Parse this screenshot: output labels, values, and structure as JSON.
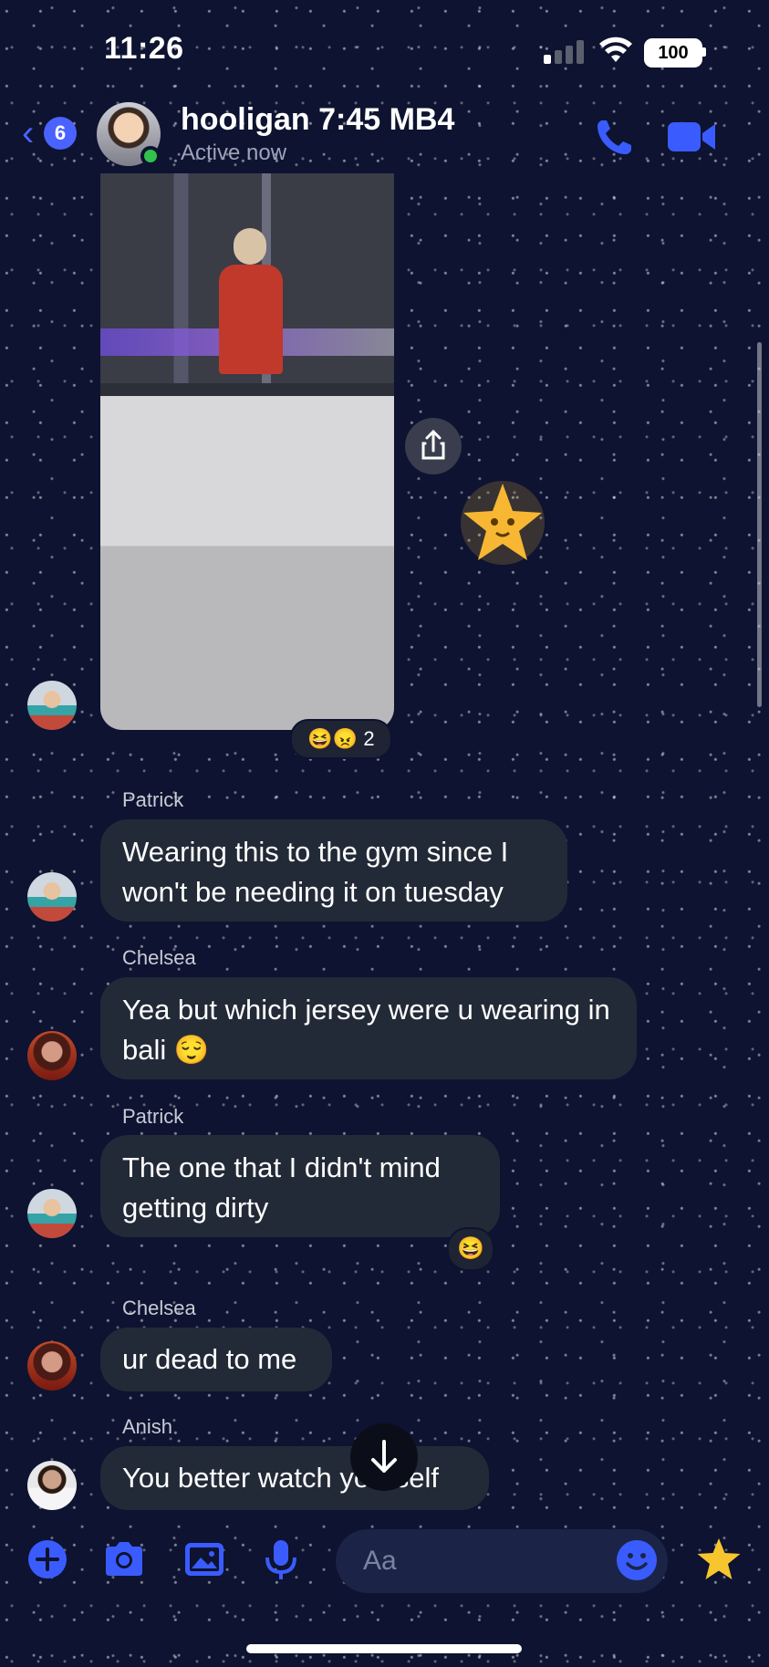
{
  "status_bar": {
    "time": "11:26",
    "battery": "100"
  },
  "header": {
    "back_badge": "6",
    "title": "hooligan 7:45 MB4",
    "subtitle": "Active now"
  },
  "photo_message": {
    "reactions": "😆😠 2"
  },
  "messages": [
    {
      "sender": "Patrick",
      "text": "Wearing this to the gym since I won't be needing it on tuesday"
    },
    {
      "sender": "Chelsea",
      "text": "Yea but which jersey were u wearing in bali 😌"
    },
    {
      "sender": "Patrick",
      "text": "The one that I didn't mind getting dirty",
      "reaction": "😆"
    },
    {
      "sender": "Chelsea",
      "text": "ur dead to me"
    },
    {
      "sender": "Anish",
      "text": "You better watch yourself"
    }
  ],
  "composer": {
    "placeholder": "Aa"
  },
  "colors": {
    "accent": "#4a63ff",
    "bubble": "#232a37",
    "background": "#0d1330"
  },
  "icons": [
    "back-chevron-icon",
    "phone-icon",
    "video-camera-icon",
    "share-icon",
    "star-sticker-icon",
    "arrow-down-icon",
    "plus-icon",
    "camera-icon",
    "image-icon",
    "microphone-icon",
    "emoji-icon",
    "star-icon"
  ]
}
